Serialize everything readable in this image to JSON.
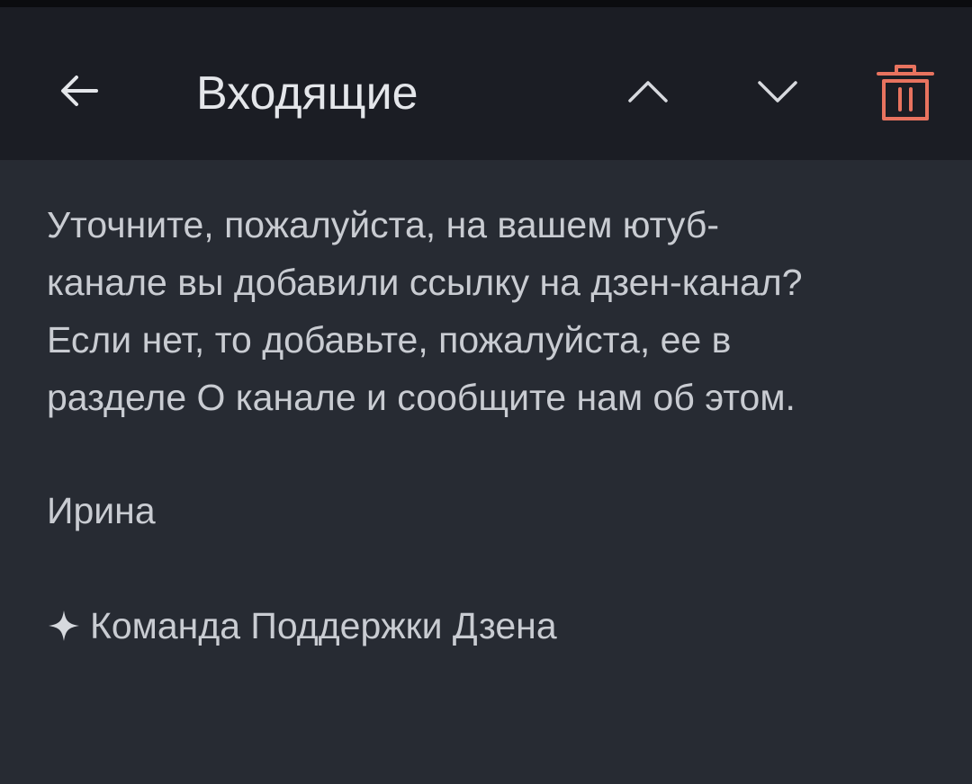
{
  "header": {
    "title": "Входящие",
    "icons": {
      "back": "arrow-left-icon",
      "up": "chevron-up-icon",
      "down": "chevron-down-icon",
      "delete": "trash-icon"
    },
    "delete_color": "#e8735f"
  },
  "message": {
    "body_lines": [
      "Уточните, пожалуйста, на вашем ютуб-",
      "канале вы добавили ссылку на дзен-канал?",
      "Если нет, то добавьте, пожалуйста, ее в",
      "разделе О канале и сообщите нам об этом."
    ],
    "signature_name": "Ирина",
    "team_signature": "Команда Поддержки Дзена",
    "team_icon": "sparkle-icon"
  },
  "colors": {
    "header_bg": "#1b1d24",
    "content_bg": "#272b33",
    "text": "#c9ccd2",
    "title": "#e4e6ea"
  }
}
